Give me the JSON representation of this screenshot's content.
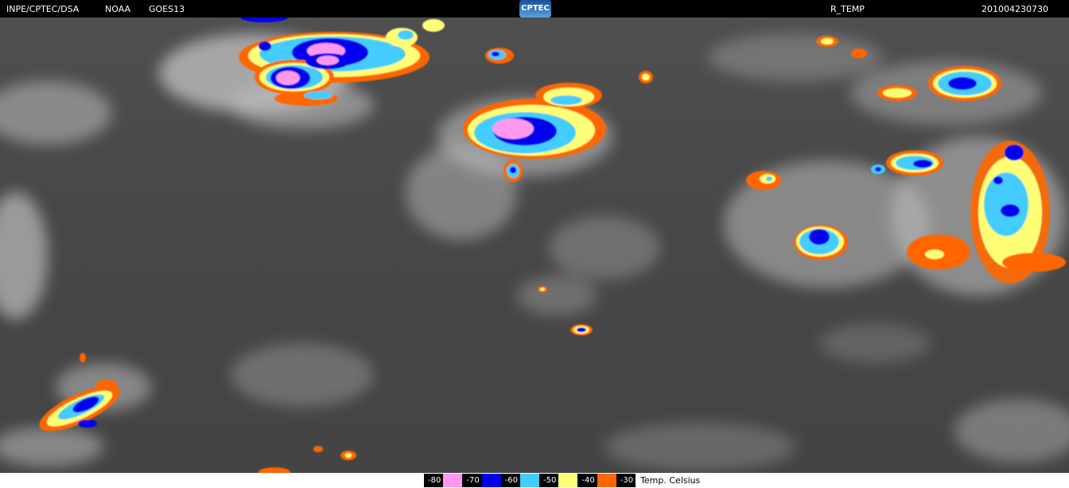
{
  "header": {
    "source": "INPE/CPTEC/DSA",
    "agency": "NOAA",
    "satellite": "GOES13",
    "logo_text": "CPTEC",
    "product": "R_TEMP",
    "timestamp": "201004230730"
  },
  "legend": {
    "unit_label": "Temp. Celsius",
    "items": [
      {
        "label": "-80",
        "color": "#ff99ee"
      },
      {
        "label": "-70",
        "color": "#0000ee"
      },
      {
        "label": "-60",
        "color": "#44ccff"
      },
      {
        "label": "-50",
        "color": "#ffff77"
      },
      {
        "label": "-40",
        "color": "#ff6600"
      },
      {
        "label": "-30",
        "color": "#ffffff"
      }
    ]
  },
  "colors": {
    "background": "#000000",
    "cloud_grey": "#cfcfcf",
    "ground_grey": "#4a4a4a"
  }
}
